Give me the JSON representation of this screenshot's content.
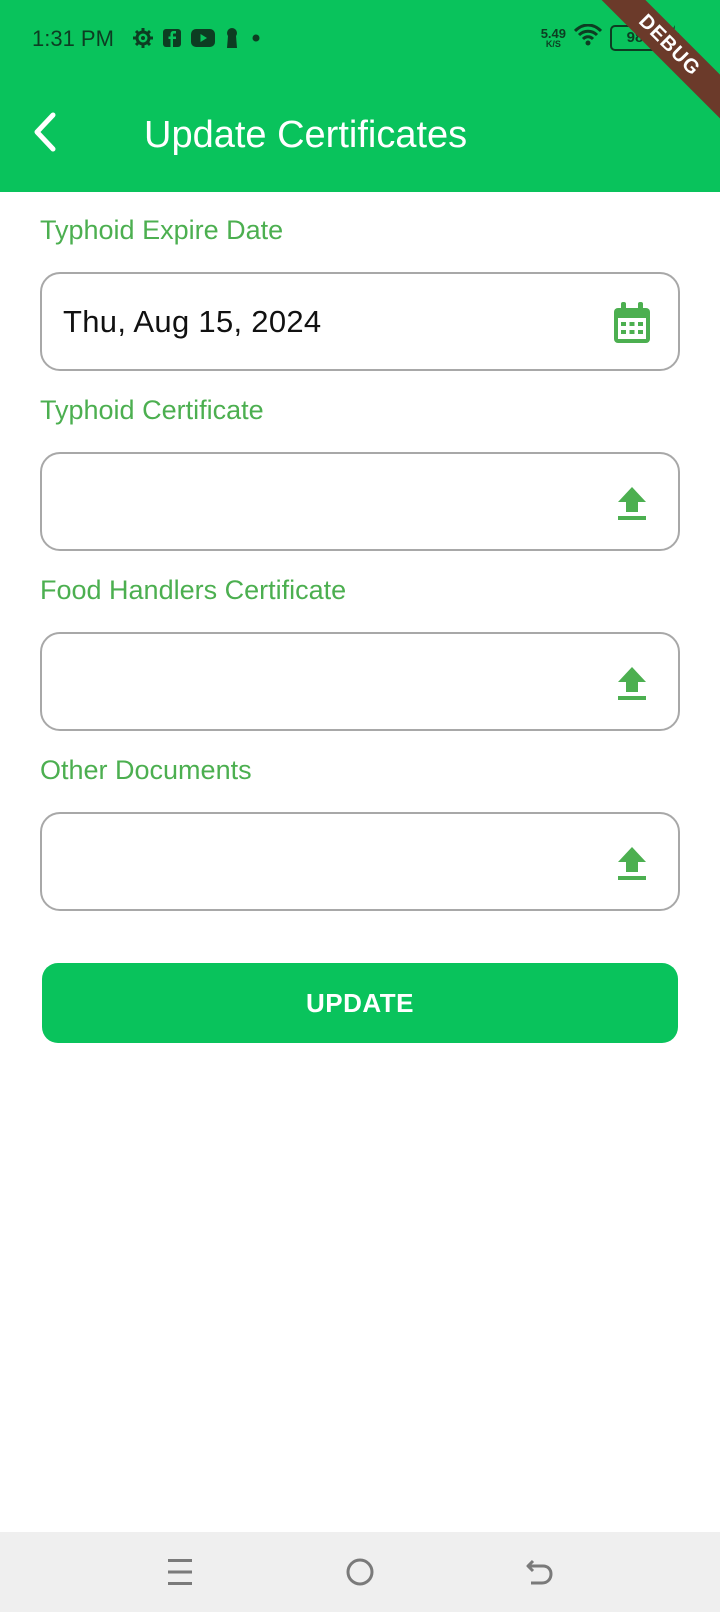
{
  "status_bar": {
    "time": "1:31 PM",
    "net_speed_value": "5.49",
    "net_speed_unit": "K/S",
    "battery_level": "98",
    "icons": [
      "settings-icon",
      "facebook-icon",
      "youtube-icon",
      "keyhole-icon",
      "dot-icon",
      "wifi-icon",
      "battery-icon",
      "charging-icon"
    ]
  },
  "debug_banner": "DEBUG",
  "app_bar": {
    "title": "Update Certificates",
    "back_icon": "chevron-left-icon"
  },
  "form": {
    "typhoid_expire": {
      "label": "Typhoid Expire Date",
      "value": "Thu, Aug 15, 2024",
      "icon": "calendar-icon"
    },
    "typhoid_certificate": {
      "label": "Typhoid Certificate",
      "value": "",
      "icon": "upload-icon"
    },
    "food_handlers_certificate": {
      "label": "Food Handlers Certificate",
      "value": "",
      "icon": "upload-icon"
    },
    "other_documents": {
      "label": "Other Documents",
      "value": "",
      "icon": "upload-icon"
    },
    "submit_label": "UPDATE"
  },
  "nav_bar": {
    "icons": [
      "menu-icon",
      "home-icon",
      "back-icon"
    ]
  },
  "colors": {
    "primary": "#09c35c",
    "label_green": "#4caf50",
    "field_border": "#a8a8a8",
    "nav_bg": "#efefef",
    "debug_ribbon": "#6b3a2a"
  }
}
